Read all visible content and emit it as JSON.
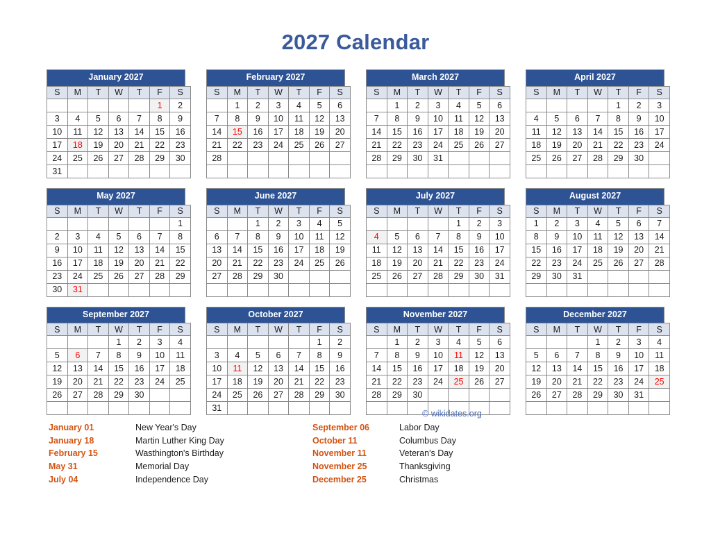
{
  "title": "2027 Calendar",
  "credit": "© wikidates.org",
  "weekdays": [
    "S",
    "M",
    "T",
    "W",
    "T",
    "F",
    "S"
  ],
  "colors": {
    "title": "#3a5a9c",
    "month_header_bg": "#2e5395",
    "weekday_bg": "#dce3ef",
    "holiday_text": "#fe0000",
    "holiday_cell_bg": "#f2f2f2",
    "holiday_list_date": "#d35413",
    "credit": "#4a6db5"
  },
  "months": [
    {
      "name": "January 2027",
      "weeks": [
        [
          "",
          "",
          "",
          "",
          "",
          "1",
          "2"
        ],
        [
          "3",
          "4",
          "5",
          "6",
          "7",
          "8",
          "9"
        ],
        [
          "10",
          "11",
          "12",
          "13",
          "14",
          "15",
          "16"
        ],
        [
          "17",
          "18",
          "19",
          "20",
          "21",
          "22",
          "23"
        ],
        [
          "24",
          "25",
          "26",
          "27",
          "28",
          "29",
          "30"
        ],
        [
          "31",
          "",
          "",
          "",
          "",
          "",
          ""
        ]
      ],
      "holidays": [
        "1",
        "18"
      ]
    },
    {
      "name": "February 2027",
      "weeks": [
        [
          "",
          "1",
          "2",
          "3",
          "4",
          "5",
          "6"
        ],
        [
          "7",
          "8",
          "9",
          "10",
          "11",
          "12",
          "13"
        ],
        [
          "14",
          "15",
          "16",
          "17",
          "18",
          "19",
          "20"
        ],
        [
          "21",
          "22",
          "23",
          "24",
          "25",
          "26",
          "27"
        ],
        [
          "28",
          "",
          "",
          "",
          "",
          "",
          ""
        ],
        [
          "",
          "",
          "",
          "",
          "",
          "",
          ""
        ]
      ],
      "holidays": [
        "15"
      ]
    },
    {
      "name": "March 2027",
      "weeks": [
        [
          "",
          "1",
          "2",
          "3",
          "4",
          "5",
          "6"
        ],
        [
          "7",
          "8",
          "9",
          "10",
          "11",
          "12",
          "13"
        ],
        [
          "14",
          "15",
          "16",
          "17",
          "18",
          "19",
          "20"
        ],
        [
          "21",
          "22",
          "23",
          "24",
          "25",
          "26",
          "27"
        ],
        [
          "28",
          "29",
          "30",
          "31",
          "",
          "",
          ""
        ],
        [
          "",
          "",
          "",
          "",
          "",
          "",
          ""
        ]
      ],
      "holidays": []
    },
    {
      "name": "April 2027",
      "weeks": [
        [
          "",
          "",
          "",
          "",
          "1",
          "2",
          "3"
        ],
        [
          "4",
          "5",
          "6",
          "7",
          "8",
          "9",
          "10"
        ],
        [
          "11",
          "12",
          "13",
          "14",
          "15",
          "16",
          "17"
        ],
        [
          "18",
          "19",
          "20",
          "21",
          "22",
          "23",
          "24"
        ],
        [
          "25",
          "26",
          "27",
          "28",
          "29",
          "30",
          ""
        ],
        [
          "",
          "",
          "",
          "",
          "",
          "",
          ""
        ]
      ],
      "holidays": []
    },
    {
      "name": "May 2027",
      "weeks": [
        [
          "",
          "",
          "",
          "",
          "",
          "",
          "1"
        ],
        [
          "2",
          "3",
          "4",
          "5",
          "6",
          "7",
          "8"
        ],
        [
          "9",
          "10",
          "11",
          "12",
          "13",
          "14",
          "15"
        ],
        [
          "16",
          "17",
          "18",
          "19",
          "20",
          "21",
          "22"
        ],
        [
          "23",
          "24",
          "25",
          "26",
          "27",
          "28",
          "29"
        ],
        [
          "30",
          "31",
          "",
          "",
          "",
          "",
          ""
        ]
      ],
      "holidays": [
        "31"
      ]
    },
    {
      "name": "June 2027",
      "weeks": [
        [
          "",
          "",
          "1",
          "2",
          "3",
          "4",
          "5"
        ],
        [
          "6",
          "7",
          "8",
          "9",
          "10",
          "11",
          "12"
        ],
        [
          "13",
          "14",
          "15",
          "16",
          "17",
          "18",
          "19"
        ],
        [
          "20",
          "21",
          "22",
          "23",
          "24",
          "25",
          "26"
        ],
        [
          "27",
          "28",
          "29",
          "30",
          "",
          "",
          ""
        ],
        [
          "",
          "",
          "",
          "",
          "",
          "",
          ""
        ]
      ],
      "holidays": []
    },
    {
      "name": "July 2027",
      "weeks": [
        [
          "",
          "",
          "",
          "",
          "1",
          "2",
          "3"
        ],
        [
          "4",
          "5",
          "6",
          "7",
          "8",
          "9",
          "10"
        ],
        [
          "11",
          "12",
          "13",
          "14",
          "15",
          "16",
          "17"
        ],
        [
          "18",
          "19",
          "20",
          "21",
          "22",
          "23",
          "24"
        ],
        [
          "25",
          "26",
          "27",
          "28",
          "29",
          "30",
          "31"
        ],
        [
          "",
          "",
          "",
          "",
          "",
          "",
          ""
        ]
      ],
      "holidays": [
        "4"
      ]
    },
    {
      "name": "August 2027",
      "weeks": [
        [
          "1",
          "2",
          "3",
          "4",
          "5",
          "6",
          "7"
        ],
        [
          "8",
          "9",
          "10",
          "11",
          "12",
          "13",
          "14"
        ],
        [
          "15",
          "16",
          "17",
          "18",
          "19",
          "20",
          "21"
        ],
        [
          "22",
          "23",
          "24",
          "25",
          "26",
          "27",
          "28"
        ],
        [
          "29",
          "30",
          "31",
          "",
          "",
          "",
          ""
        ],
        [
          "",
          "",
          "",
          "",
          "",
          "",
          ""
        ]
      ],
      "holidays": []
    },
    {
      "name": "September 2027",
      "weeks": [
        [
          "",
          "",
          "",
          "1",
          "2",
          "3",
          "4"
        ],
        [
          "5",
          "6",
          "7",
          "8",
          "9",
          "10",
          "11"
        ],
        [
          "12",
          "13",
          "14",
          "15",
          "16",
          "17",
          "18"
        ],
        [
          "19",
          "20",
          "21",
          "22",
          "23",
          "24",
          "25"
        ],
        [
          "26",
          "27",
          "28",
          "29",
          "30",
          "",
          ""
        ],
        [
          "",
          "",
          "",
          "",
          "",
          "",
          ""
        ]
      ],
      "holidays": [
        "6"
      ]
    },
    {
      "name": "October 2027",
      "weeks": [
        [
          "",
          "",
          "",
          "",
          "",
          "1",
          "2"
        ],
        [
          "3",
          "4",
          "5",
          "6",
          "7",
          "8",
          "9"
        ],
        [
          "10",
          "11",
          "12",
          "13",
          "14",
          "15",
          "16"
        ],
        [
          "17",
          "18",
          "19",
          "20",
          "21",
          "22",
          "23"
        ],
        [
          "24",
          "25",
          "26",
          "27",
          "28",
          "29",
          "30"
        ],
        [
          "31",
          "",
          "",
          "",
          "",
          "",
          ""
        ]
      ],
      "holidays": [
        "11"
      ]
    },
    {
      "name": "November 2027",
      "weeks": [
        [
          "",
          "1",
          "2",
          "3",
          "4",
          "5",
          "6"
        ],
        [
          "7",
          "8",
          "9",
          "10",
          "11",
          "12",
          "13"
        ],
        [
          "14",
          "15",
          "16",
          "17",
          "18",
          "19",
          "20"
        ],
        [
          "21",
          "22",
          "23",
          "24",
          "25",
          "26",
          "27"
        ],
        [
          "28",
          "29",
          "30",
          "",
          "",
          "",
          ""
        ],
        [
          "",
          "",
          "",
          "",
          "",
          "",
          ""
        ]
      ],
      "holidays": [
        "11",
        "25"
      ]
    },
    {
      "name": "December 2027",
      "weeks": [
        [
          "",
          "",
          "",
          "1",
          "2",
          "3",
          "4"
        ],
        [
          "5",
          "6",
          "7",
          "8",
          "9",
          "10",
          "11"
        ],
        [
          "12",
          "13",
          "14",
          "15",
          "16",
          "17",
          "18"
        ],
        [
          "19",
          "20",
          "21",
          "22",
          "23",
          "24",
          "25"
        ],
        [
          "26",
          "27",
          "28",
          "29",
          "30",
          "31",
          ""
        ],
        [
          "",
          "",
          "",
          "",
          "",
          "",
          ""
        ]
      ],
      "holidays": [
        "25"
      ]
    }
  ],
  "holiday_list": [
    {
      "date": "January 01",
      "name": "New Year's Day",
      "column": 0
    },
    {
      "date": "January 18",
      "name": "Martin Luther King Day",
      "column": 0
    },
    {
      "date": "February 15",
      "name": "Wasthington's Birthday",
      "column": 0
    },
    {
      "date": "May 31",
      "name": "Memorial Day",
      "column": 0
    },
    {
      "date": "July 04",
      "name": "Independence Day",
      "column": 0
    },
    {
      "date": "September 06",
      "name": "Labor Day",
      "column": 1
    },
    {
      "date": "October 11",
      "name": "Columbus Day",
      "column": 1
    },
    {
      "date": "November 11",
      "name": "Veteran's Day",
      "column": 1
    },
    {
      "date": "November 25",
      "name": "Thanksgiving",
      "column": 1
    },
    {
      "date": "December 25",
      "name": "Christmas",
      "column": 1
    }
  ]
}
